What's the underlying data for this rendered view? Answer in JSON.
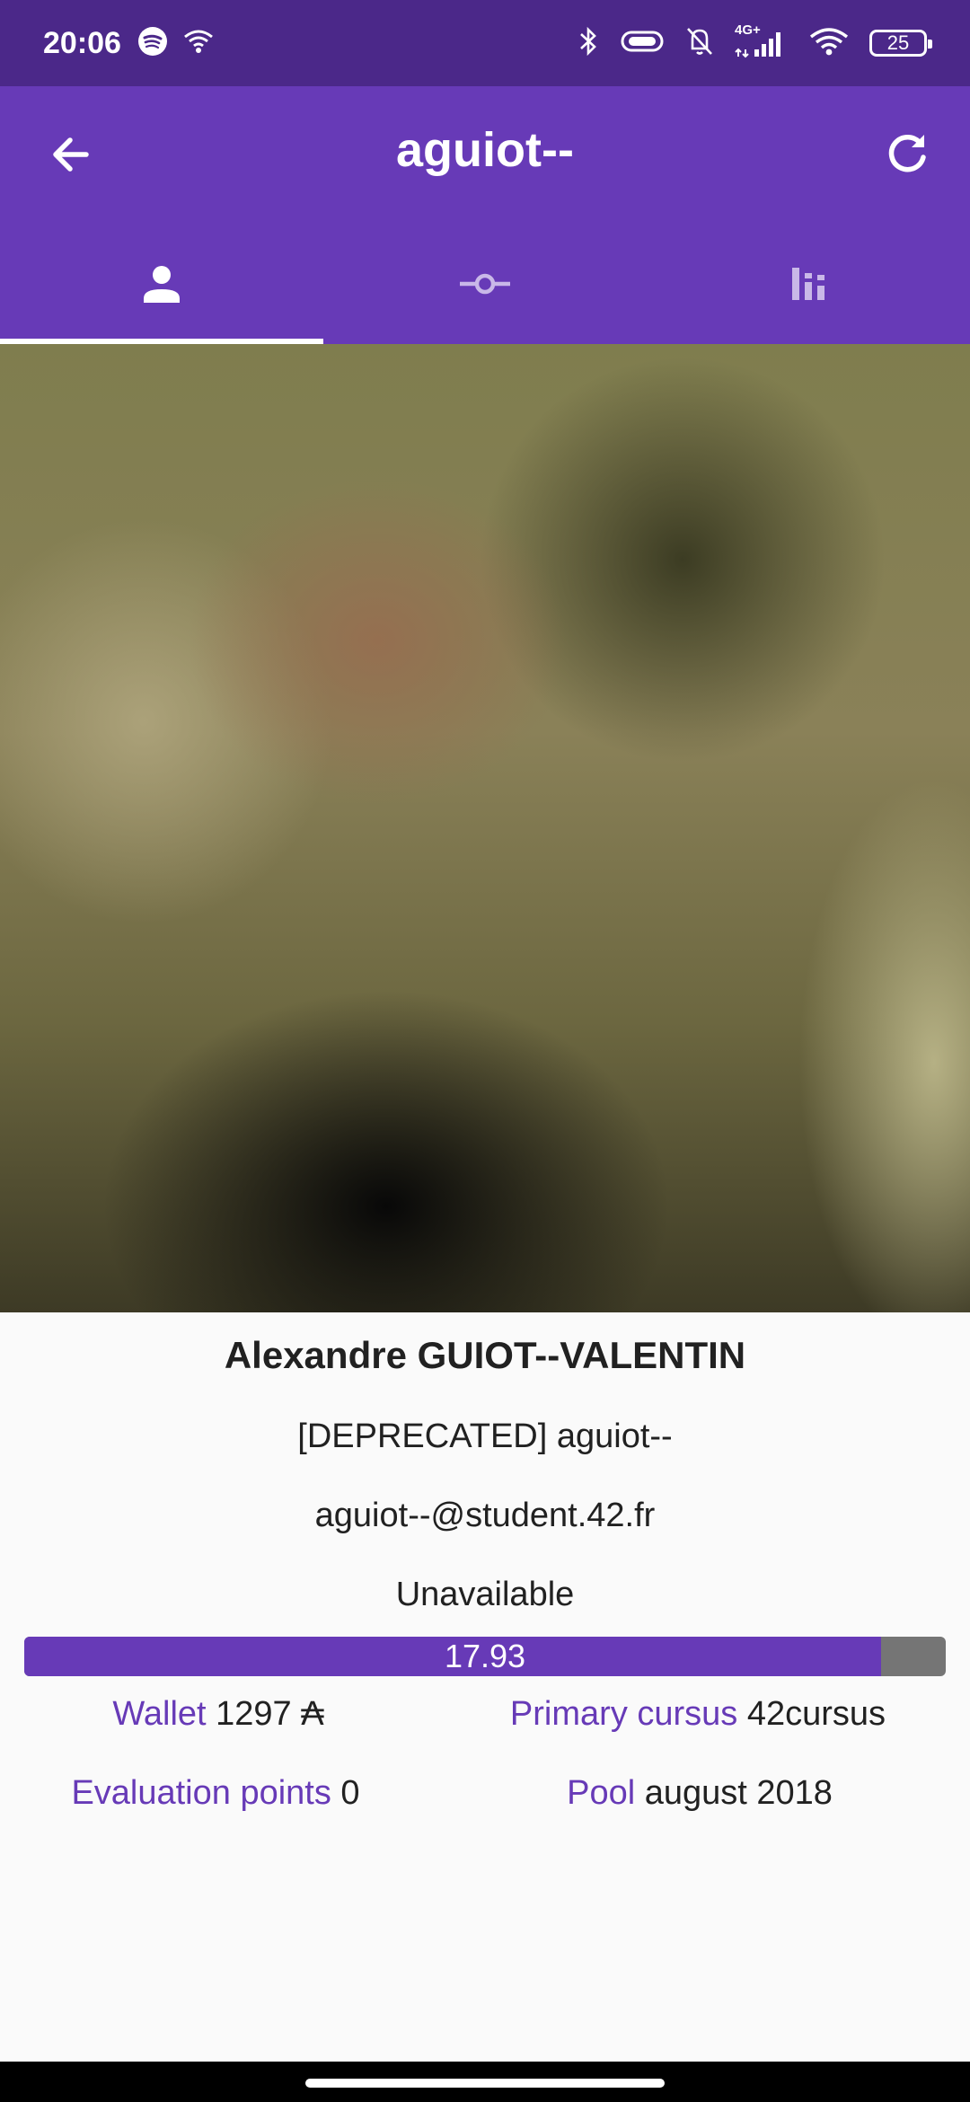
{
  "status_bar": {
    "time": "20:06",
    "battery": "25",
    "network": "4G+",
    "icons": [
      "spotify-icon",
      "wifi-calling-icon",
      "bluetooth-icon",
      "vibrate-icon",
      "notifications-off-icon",
      "signal-icon",
      "wifi-icon",
      "battery-icon"
    ]
  },
  "app_bar": {
    "title": "aguiot--",
    "back_icon": "arrow-back-icon",
    "refresh_icon": "refresh-icon"
  },
  "tabs": [
    {
      "icon": "person-icon",
      "active": true
    },
    {
      "icon": "commit-icon",
      "active": false
    },
    {
      "icon": "bar-chart-icon",
      "active": false
    }
  ],
  "profile": {
    "full_name": "Alexandre GUIOT--VALENTIN",
    "display_login": "[DEPRECATED] aguiot--",
    "email": "aguiot--@student.42.fr",
    "location": "Unavailable",
    "level_text": "17.93",
    "level_progress": 0.93,
    "wallet": {
      "label": "Wallet",
      "value": "1297 ₳"
    },
    "primary_cursus": {
      "label": "Primary cursus",
      "value": "42cursus"
    },
    "evaluation_points": {
      "label": "Evaluation points",
      "value": "0"
    },
    "pool": {
      "label": "Pool",
      "value": "august 2018"
    }
  },
  "colors": {
    "primary": "#673ab7",
    "status_bar": "#4b2889",
    "level_remaining": "#757575",
    "background": "#fafafa"
  }
}
